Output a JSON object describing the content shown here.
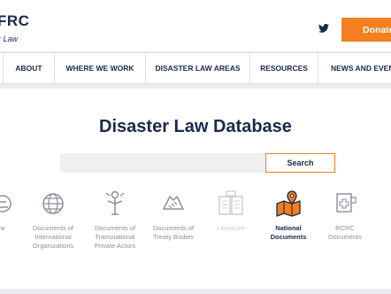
{
  "header": {
    "logo_text": "FRC",
    "logo_sub": "r Law",
    "donate_label": "Donate"
  },
  "nav": {
    "items": [
      {
        "label": "ABOUT"
      },
      {
        "label": "WHERE WE WORK"
      },
      {
        "label": "DISASTER LAW AREAS"
      },
      {
        "label": "RESOURCES"
      },
      {
        "label": "NEWS AND EVEN"
      }
    ]
  },
  "main": {
    "title": "Disaster Law Database",
    "search_value": "",
    "search_button": "Search"
  },
  "categories": [
    {
      "label": "w",
      "icon": "law-document-icon"
    },
    {
      "label": "Documents of International Organizations",
      "icon": "globe-icon"
    },
    {
      "label": "Documents of Transnational Private Actors",
      "icon": "person-icon"
    },
    {
      "label": "Documents of Treaty Bodies",
      "icon": "handshake-icon"
    },
    {
      "label": "Literature",
      "icon": "book-icon"
    },
    {
      "label": "National Documents",
      "icon": "map-pin-icon"
    },
    {
      "label": "RCRC Documents",
      "icon": "red-cross-document-icon"
    }
  ],
  "colors": {
    "accent": "#f37f1e",
    "navy": "#1b2a4a",
    "muted": "#8a8f99"
  }
}
